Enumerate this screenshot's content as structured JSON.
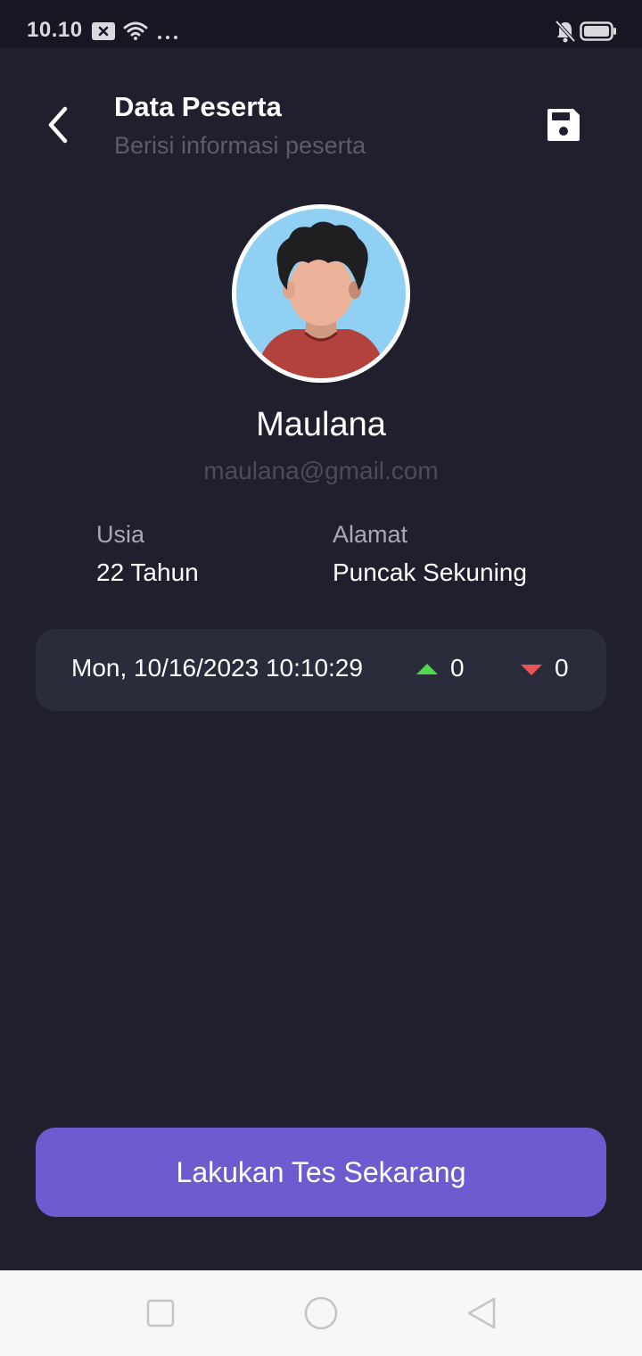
{
  "status_bar": {
    "time": "10.10",
    "icons": [
      "close-notification-icon",
      "wifi-icon",
      "more-dots-icon",
      "mute-notification-icon",
      "battery-icon"
    ]
  },
  "header": {
    "title": "Data Peserta",
    "subtitle": "Berisi informasi peserta",
    "back_icon": "chevron-left-icon",
    "save_icon": "floppy-disk-icon"
  },
  "profile": {
    "name": "Maulana",
    "email": "maulana@gmail.com",
    "avatar": "person-avatar"
  },
  "info": {
    "age_label": "Usia",
    "age_value": "22 Tahun",
    "address_label": "Alamat",
    "address_value": "Puncak Sekuning"
  },
  "record": {
    "datetime": "Mon, 10/16/2023 10:10:29",
    "up_count": "0",
    "down_count": "0",
    "up_color": "#4fd94f",
    "down_color": "#e85555"
  },
  "cta": {
    "label": "Lakukan Tes Sekarang",
    "color": "#6c5ccf"
  },
  "nav_bar": {
    "icons": [
      "recent-apps-icon",
      "home-icon",
      "back-triangle-icon"
    ]
  },
  "colors": {
    "background": "#201f2e",
    "card": "#2a2c3b"
  }
}
